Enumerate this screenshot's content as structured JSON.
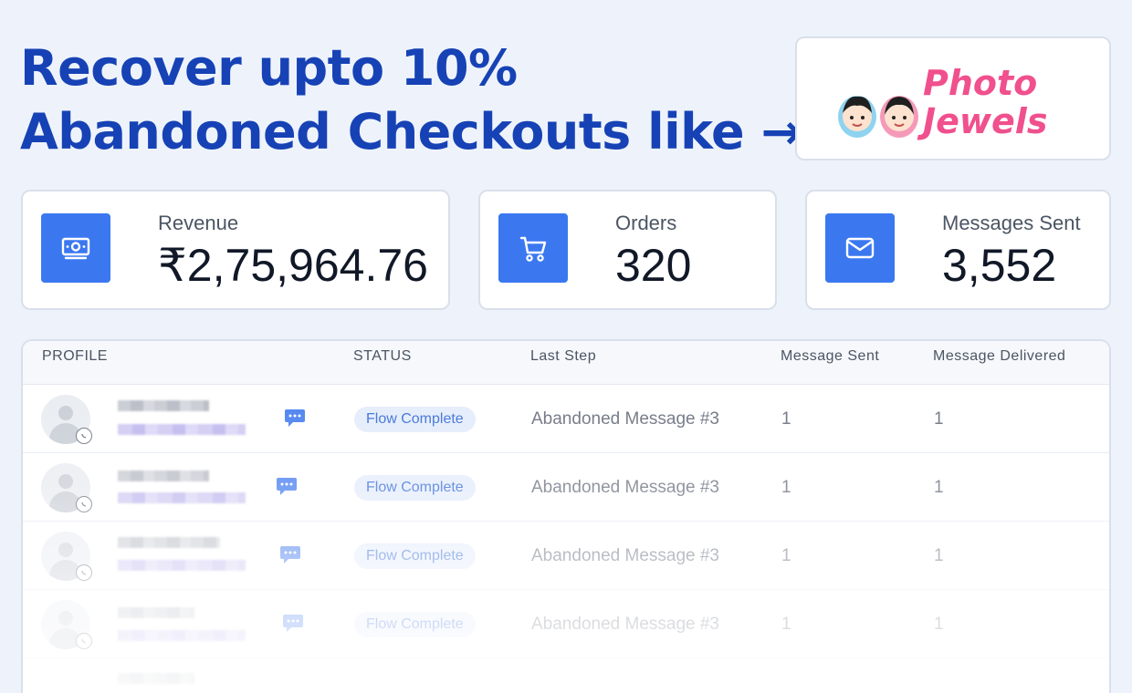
{
  "headline": {
    "line1": "Recover upto 10%",
    "line2": "Abandoned Checkouts like →"
  },
  "logo": {
    "line1": "Photo",
    "line2": "Jewels",
    "color": "#f0508d"
  },
  "stats": [
    {
      "label": "Revenue",
      "value": "₹2,75,964.76",
      "icon": "money-icon"
    },
    {
      "label": "Orders",
      "value": "320",
      "icon": "cart-icon"
    },
    {
      "label": "Messages Sent",
      "value": "3,552",
      "icon": "envelope-icon"
    }
  ],
  "table": {
    "headers": {
      "profile": "PROFILE",
      "status": "STATUS",
      "last_step": "Last Step",
      "message_sent": "Message Sent",
      "message_delivered": "Message Delivered"
    },
    "rows": [
      {
        "status": "Flow Complete",
        "last_step": "Abandoned Message #3",
        "sent": "1",
        "delivered": "1"
      },
      {
        "status": "Flow Complete",
        "last_step": "Abandoned Message #3",
        "sent": "1",
        "delivered": "1"
      },
      {
        "status": "Flow Complete",
        "last_step": "Abandoned Message #3",
        "sent": "1",
        "delivered": "1"
      },
      {
        "status": "Flow Complete",
        "last_step": "Abandoned Message #3",
        "sent": "1",
        "delivered": "1"
      }
    ]
  },
  "colors": {
    "accent": "#3b78f0",
    "headline": "#1642b5",
    "background": "#eef3fb"
  }
}
